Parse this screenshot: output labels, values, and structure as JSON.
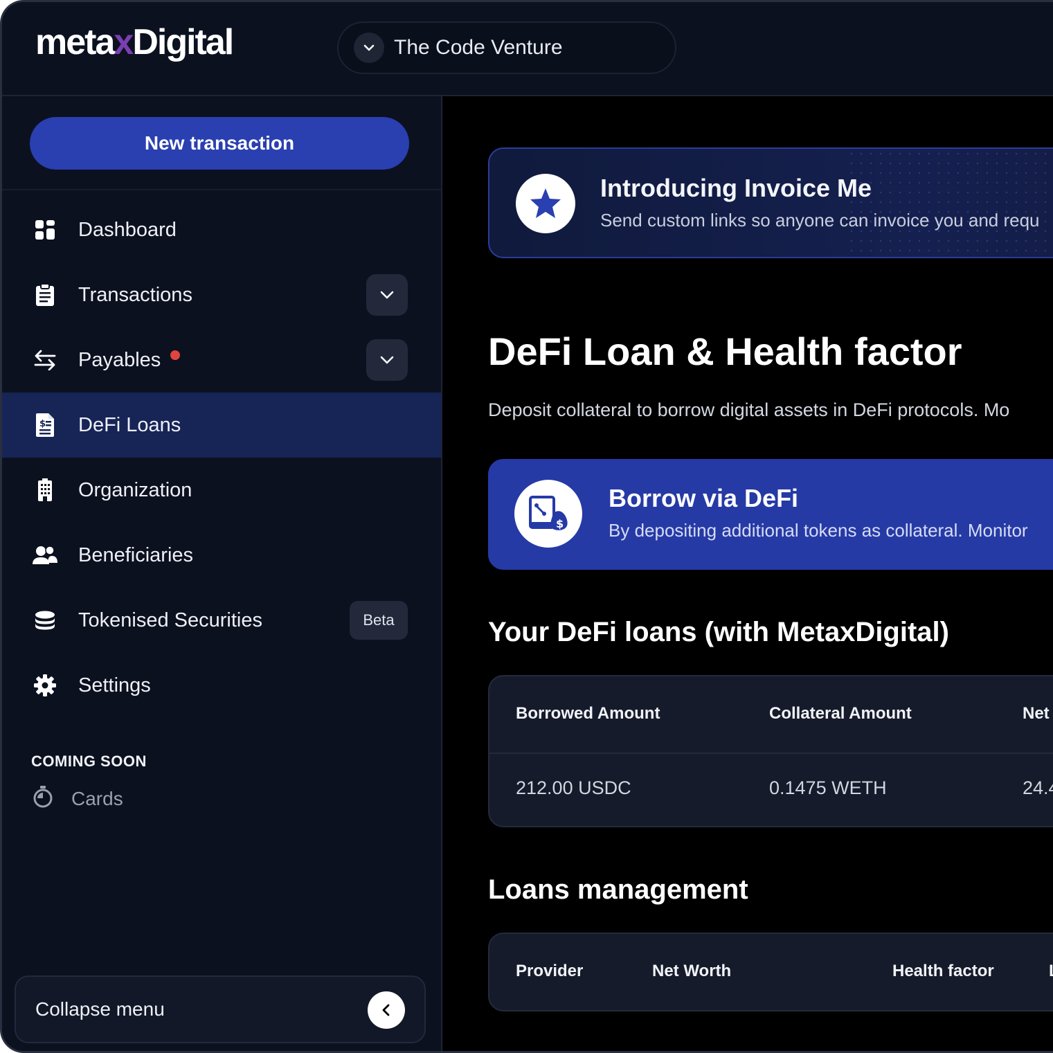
{
  "app": {
    "logo_left": "meta",
    "logo_x": "x",
    "logo_right": "Digital",
    "organization": "The Code Venture"
  },
  "sidebar": {
    "new_transaction": "New transaction",
    "items": [
      {
        "label": "Dashboard",
        "icon": "dashboard-icon"
      },
      {
        "label": "Transactions",
        "icon": "clipboard-icon",
        "expandable": true
      },
      {
        "label": "Payables",
        "icon": "swap-arrows-icon",
        "expandable": true,
        "notification_dot": true
      },
      {
        "label": "DeFi Loans",
        "icon": "loan-document-icon",
        "active": true
      },
      {
        "label": "Organization",
        "icon": "building-icon"
      },
      {
        "label": "Beneficiaries",
        "icon": "users-icon"
      },
      {
        "label": "Tokenised Securities",
        "icon": "coins-stack-icon",
        "badge": "Beta"
      },
      {
        "label": "Settings",
        "icon": "gear-icon"
      }
    ],
    "coming_soon_heading": "COMING SOON",
    "coming_soon_items": [
      {
        "label": "Cards",
        "icon": "stopwatch-icon"
      }
    ],
    "collapse_label": "Collapse menu"
  },
  "main": {
    "promo": {
      "title": "Introducing Invoice Me",
      "subtitle": "Send custom links so anyone can invoice you and requ"
    },
    "heading": "DeFi Loan & Health factor",
    "description": "Deposit collateral to borrow digital assets in DeFi protocols. Mo",
    "borrow": {
      "title": "Borrow via DeFi",
      "subtitle": "By depositing additional tokens as collateral. Monitor"
    },
    "loans_heading": "Your DeFi loans (with MetaxDigital)",
    "loans_table": {
      "columns": [
        "Borrowed Amount",
        "Collateral Amount",
        "Net"
      ],
      "rows": [
        [
          "212.00 USDC",
          "0.1475 WETH",
          "24.4"
        ]
      ]
    },
    "mgmt_heading": "Loans management",
    "mgmt_table": {
      "columns": [
        "Provider",
        "Net Worth",
        "Health factor",
        "L"
      ]
    }
  },
  "colors": {
    "accent": "#2a3fb0",
    "active_nav": "#172456",
    "notification": "#e0443f",
    "logo_x": "#7a3fb2"
  }
}
